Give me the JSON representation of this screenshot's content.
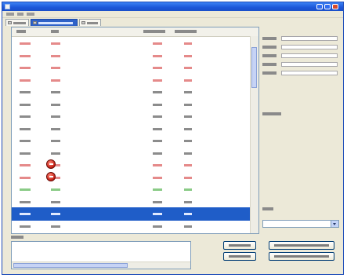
{
  "window": {
    "title": "",
    "menu": [
      "",
      "",
      ""
    ]
  },
  "tabs": [
    {
      "label": "",
      "active": false
    },
    {
      "label": "",
      "active": true
    },
    {
      "label": "",
      "active": false
    }
  ],
  "list": {
    "columns": [
      "",
      "",
      "",
      ""
    ],
    "rows": [
      {
        "cells": [
          "",
          "",
          "",
          ""
        ],
        "tone": "red",
        "error": false,
        "selected": false
      },
      {
        "cells": [
          "",
          "",
          "",
          ""
        ],
        "tone": "red",
        "error": false,
        "selected": false
      },
      {
        "cells": [
          "",
          "",
          "",
          ""
        ],
        "tone": "red",
        "error": false,
        "selected": false
      },
      {
        "cells": [
          "",
          "",
          "",
          ""
        ],
        "tone": "red",
        "error": false,
        "selected": false
      },
      {
        "cells": [
          "",
          "",
          "",
          ""
        ],
        "tone": "normal",
        "error": false,
        "selected": false
      },
      {
        "cells": [
          "",
          "",
          "",
          ""
        ],
        "tone": "normal",
        "error": false,
        "selected": false
      },
      {
        "cells": [
          "",
          "",
          "",
          ""
        ],
        "tone": "normal",
        "error": false,
        "selected": false
      },
      {
        "cells": [
          "",
          "",
          "",
          ""
        ],
        "tone": "normal",
        "error": false,
        "selected": false
      },
      {
        "cells": [
          "",
          "",
          "",
          ""
        ],
        "tone": "normal",
        "error": false,
        "selected": false
      },
      {
        "cells": [
          "",
          "",
          "",
          ""
        ],
        "tone": "normal",
        "error": false,
        "selected": false
      },
      {
        "cells": [
          "",
          "",
          "",
          ""
        ],
        "tone": "red",
        "error": true,
        "selected": false
      },
      {
        "cells": [
          "",
          "",
          "",
          ""
        ],
        "tone": "red",
        "error": true,
        "selected": false
      },
      {
        "cells": [
          "",
          "",
          "",
          ""
        ],
        "tone": "green",
        "error": false,
        "selected": false
      },
      {
        "cells": [
          "",
          "",
          "",
          ""
        ],
        "tone": "normal",
        "error": false,
        "selected": false
      },
      {
        "cells": [
          "",
          "",
          "",
          ""
        ],
        "tone": "normal",
        "error": false,
        "selected": true
      },
      {
        "cells": [
          "",
          "",
          "",
          ""
        ],
        "tone": "normal",
        "error": false,
        "selected": false
      }
    ]
  },
  "side_panel": {
    "fields": [
      {
        "label": "",
        "value": ""
      },
      {
        "label": "",
        "value": ""
      },
      {
        "label": "",
        "value": ""
      },
      {
        "label": "",
        "value": ""
      },
      {
        "label": "",
        "value": ""
      }
    ],
    "section_label": "",
    "dropdown_label": "",
    "dropdown_value": ""
  },
  "bottom": {
    "label": "",
    "text": ""
  },
  "buttons": [
    {
      "label": ""
    },
    {
      "label": ""
    },
    {
      "label": ""
    },
    {
      "label": ""
    }
  ],
  "colors": {
    "titlebar": "#1c56d8",
    "selection": "#1f5dc8",
    "error": "#c51d12",
    "red_text": "#e58a8a",
    "green_text": "#8acb86"
  }
}
